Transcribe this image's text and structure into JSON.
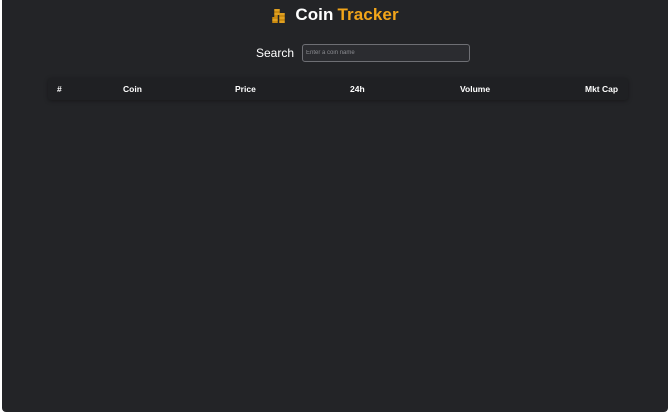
{
  "header": {
    "title_part1": "Coin",
    "title_part2": "Tracker",
    "logo_icon": "coin-stack-icon",
    "accent_color": "#f2a51a"
  },
  "search": {
    "label": "Search",
    "placeholder": "Enter a coin name",
    "value": ""
  },
  "table": {
    "columns": [
      "#",
      "Coin",
      "Price",
      "24h",
      "Volume",
      "Mkt Cap"
    ],
    "rows": []
  }
}
